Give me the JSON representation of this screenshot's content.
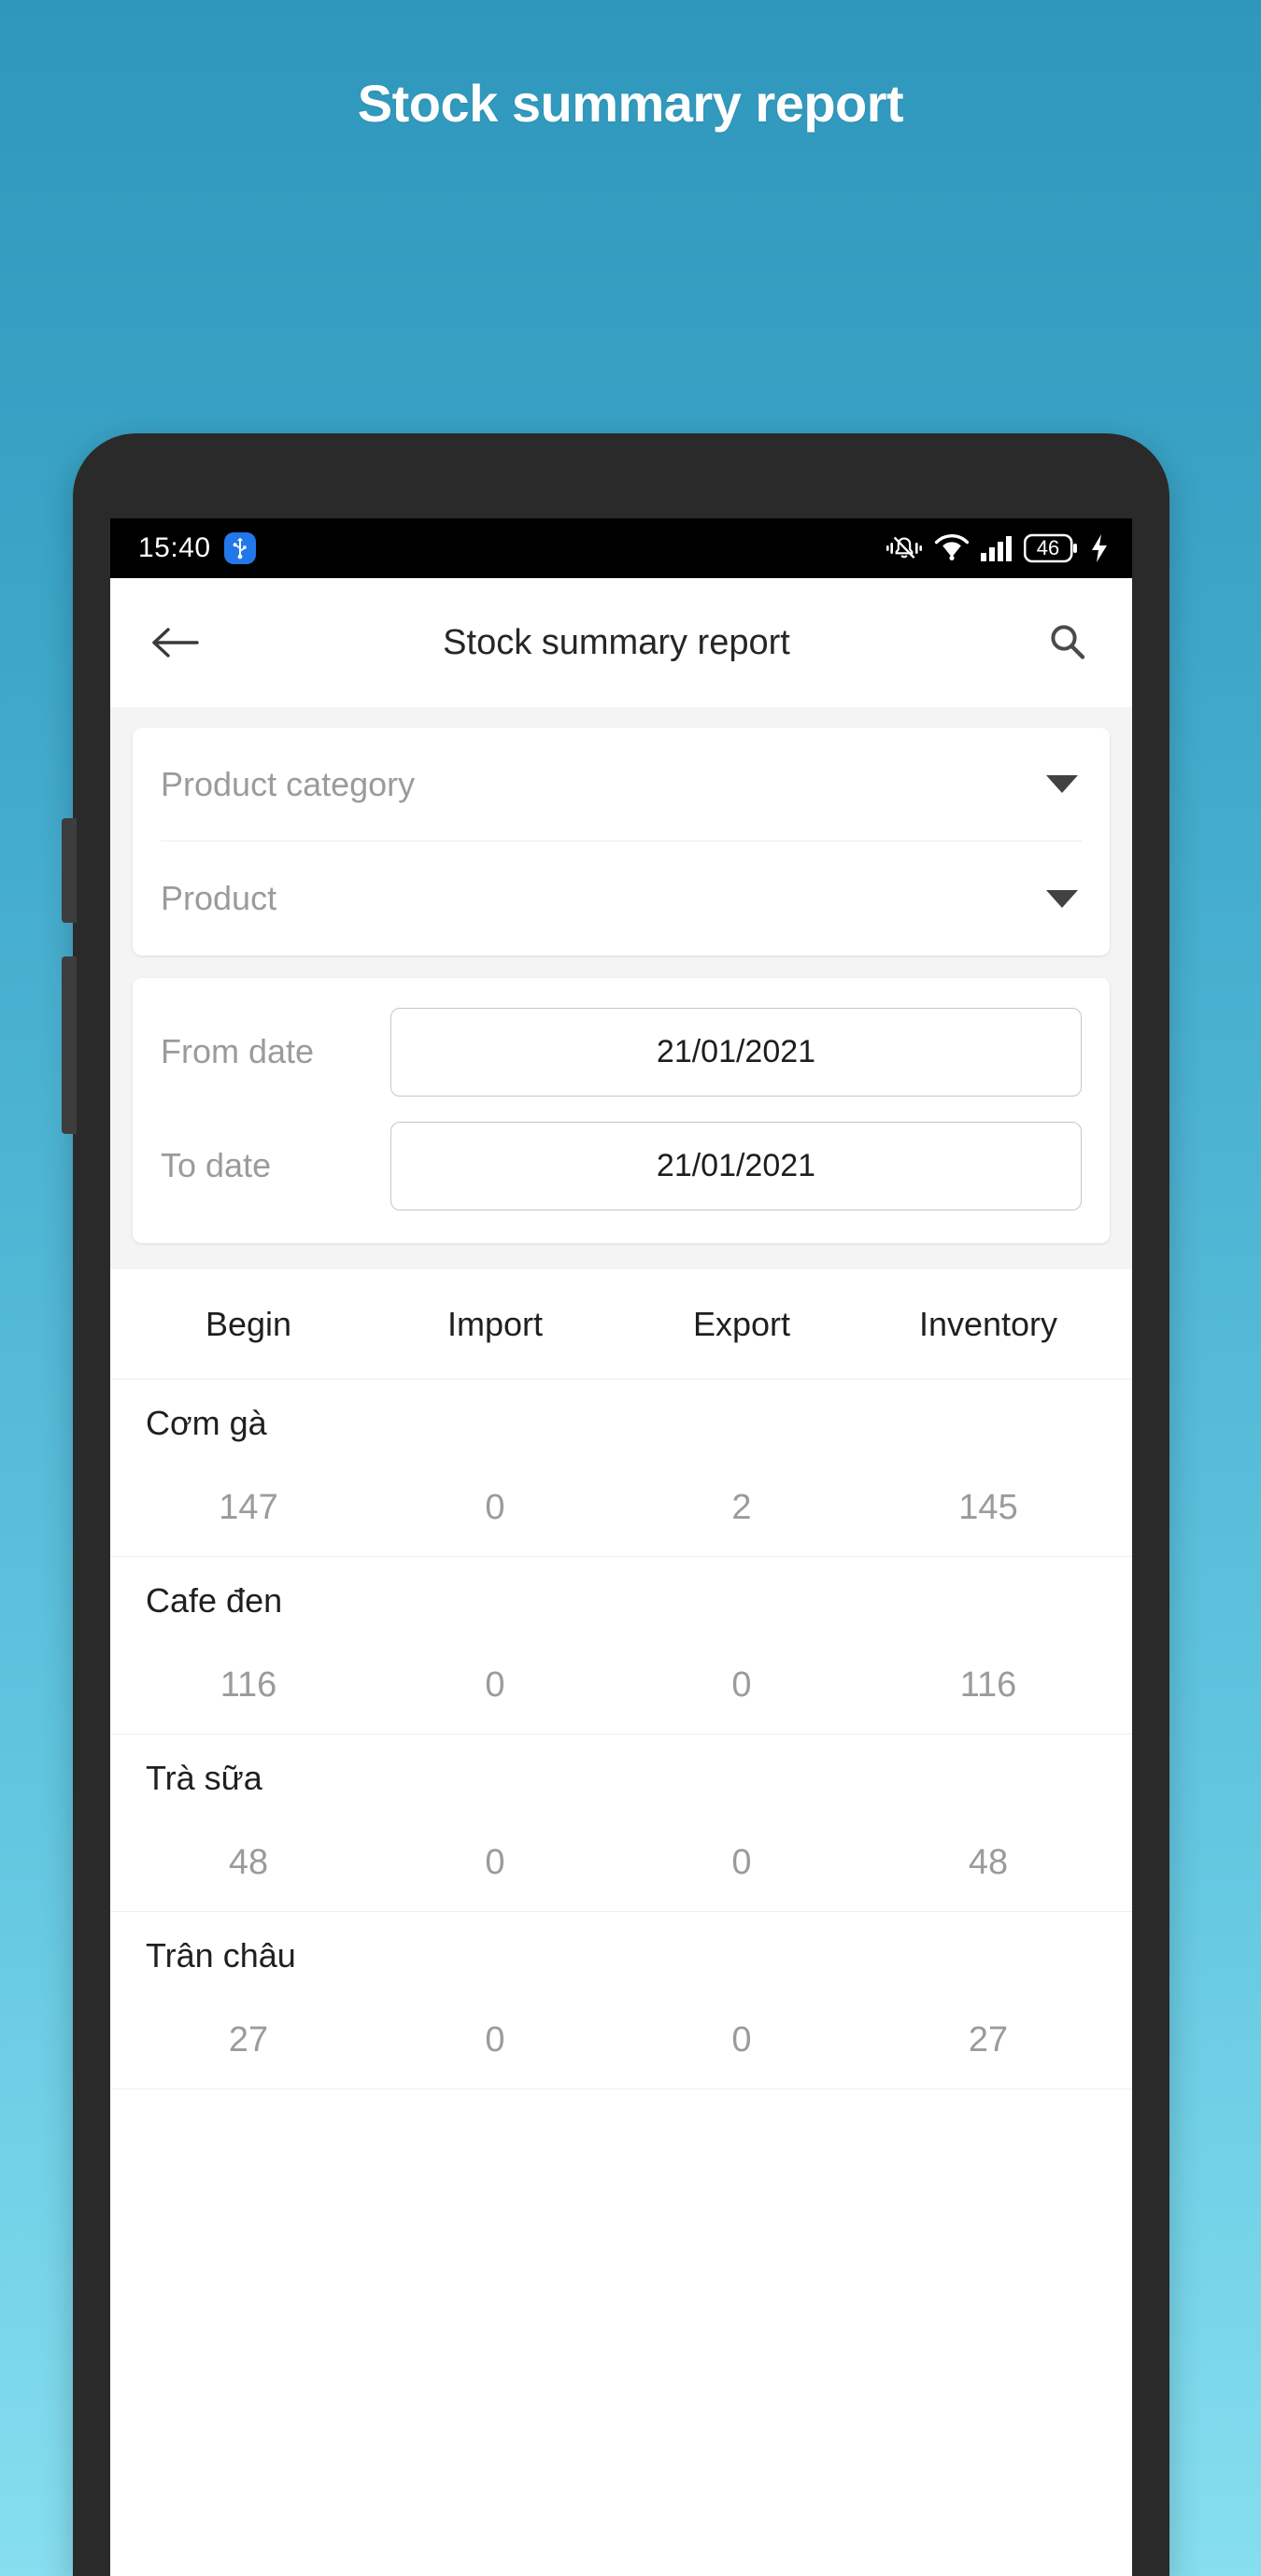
{
  "promo": {
    "headline": "Stock summary report"
  },
  "status_bar": {
    "time": "15:40",
    "icons": [
      "usb-icon",
      "vibrate-icon",
      "wifi-icon",
      "cellular-signal-icon",
      "battery-icon",
      "charging-bolt-icon"
    ],
    "battery_level": "46"
  },
  "app_bar": {
    "back_icon": "back-arrow-icon",
    "title": "Stock summary report",
    "search_icon": "search-icon"
  },
  "filters": {
    "category_select": {
      "label": "Product category",
      "caret_icon": "chevron-down-icon"
    },
    "product_select": {
      "label": "Product",
      "caret_icon": "chevron-down-icon"
    },
    "from_date": {
      "label": "From date",
      "value": "21/01/2021"
    },
    "to_date": {
      "label": "To date",
      "value": "21/01/2021"
    }
  },
  "table": {
    "columns": [
      "Begin",
      "Import",
      "Export",
      "Inventory"
    ],
    "rows": [
      {
        "name": "Cơm gà",
        "begin": "147",
        "import": "0",
        "export": "2",
        "inventory": "145"
      },
      {
        "name": "Cafe đen",
        "begin": "116",
        "import": "0",
        "export": "0",
        "inventory": "116"
      },
      {
        "name": "Trà sữa",
        "begin": "48",
        "import": "0",
        "export": "0",
        "inventory": "48"
      },
      {
        "name": "Trân châu",
        "begin": "27",
        "import": "0",
        "export": "0",
        "inventory": "27"
      }
    ]
  },
  "colors": {
    "background_top": "#2f97bb",
    "background_bottom": "#86deef",
    "phone_frame": "#2a2a2a",
    "status_bar": "#000000",
    "filter_bg": "#f4f4f4",
    "muted_text": "#9b9b9b",
    "primary_text": "#1f1f1f",
    "usb_badge": "#2277ea"
  }
}
